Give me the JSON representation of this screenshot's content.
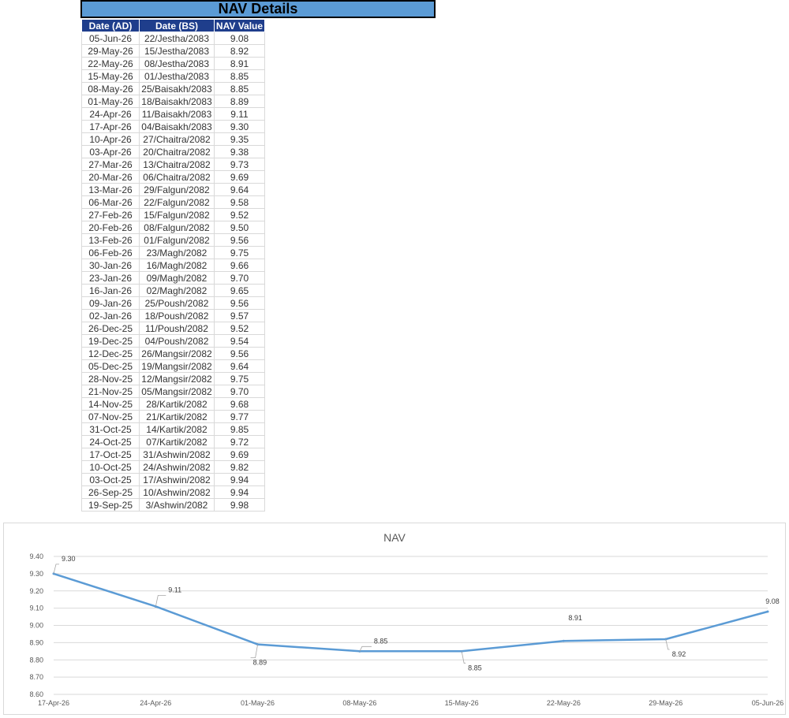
{
  "header": {
    "title": "NAV Details"
  },
  "table": {
    "columns": [
      "Date (AD)",
      "Date (BS)",
      "NAV Value"
    ],
    "rows": [
      [
        "05-Jun-26",
        "22/Jestha/2083",
        "9.08"
      ],
      [
        "29-May-26",
        "15/Jestha/2083",
        "8.92"
      ],
      [
        "22-May-26",
        "08/Jestha/2083",
        "8.91"
      ],
      [
        "15-May-26",
        "01/Jestha/2083",
        "8.85"
      ],
      [
        "08-May-26",
        "25/Baisakh/2083",
        "8.85"
      ],
      [
        "01-May-26",
        "18/Baisakh/2083",
        "8.89"
      ],
      [
        "24-Apr-26",
        "11/Baisakh/2083",
        "9.11"
      ],
      [
        "17-Apr-26",
        "04/Baisakh/2083",
        "9.30"
      ],
      [
        "10-Apr-26",
        "27/Chaitra/2082",
        "9.35"
      ],
      [
        "03-Apr-26",
        "20/Chaitra/2082",
        "9.38"
      ],
      [
        "27-Mar-26",
        "13/Chaitra/2082",
        "9.73"
      ],
      [
        "20-Mar-26",
        "06/Chaitra/2082",
        "9.69"
      ],
      [
        "13-Mar-26",
        "29/Falgun/2082",
        "9.64"
      ],
      [
        "06-Mar-26",
        "22/Falgun/2082",
        "9.58"
      ],
      [
        "27-Feb-26",
        "15/Falgun/2082",
        "9.52"
      ],
      [
        "20-Feb-26",
        "08/Falgun/2082",
        "9.50"
      ],
      [
        "13-Feb-26",
        "01/Falgun/2082",
        "9.56"
      ],
      [
        "06-Feb-26",
        "23/Magh/2082",
        "9.75"
      ],
      [
        "30-Jan-26",
        "16/Magh/2082",
        "9.66"
      ],
      [
        "23-Jan-26",
        "09/Magh/2082",
        "9.70"
      ],
      [
        "16-Jan-26",
        "02/Magh/2082",
        "9.65"
      ],
      [
        "09-Jan-26",
        "25/Poush/2082",
        "9.56"
      ],
      [
        "02-Jan-26",
        "18/Poush/2082",
        "9.57"
      ],
      [
        "26-Dec-25",
        "11/Poush/2082",
        "9.52"
      ],
      [
        "19-Dec-25",
        "04/Poush/2082",
        "9.54"
      ],
      [
        "12-Dec-25",
        "26/Mangsir/2082",
        "9.56"
      ],
      [
        "05-Dec-25",
        "19/Mangsir/2082",
        "9.64"
      ],
      [
        "28-Nov-25",
        "12/Mangsir/2082",
        "9.75"
      ],
      [
        "21-Nov-25",
        "05/Mangsir/2082",
        "9.70"
      ],
      [
        "14-Nov-25",
        "28/Kartik/2082",
        "9.68"
      ],
      [
        "07-Nov-25",
        "21/Kartik/2082",
        "9.77"
      ],
      [
        "31-Oct-25",
        "14/Kartik/2082",
        "9.85"
      ],
      [
        "24-Oct-25",
        "07/Kartik/2082",
        "9.72"
      ],
      [
        "17-Oct-25",
        "31/Ashwin/2082",
        "9.69"
      ],
      [
        "10-Oct-25",
        "24/Ashwin/2082",
        "9.82"
      ],
      [
        "03-Oct-25",
        "17/Ashwin/2082",
        "9.94"
      ],
      [
        "26-Sep-25",
        "10/Ashwin/2082",
        "9.94"
      ],
      [
        "19-Sep-25",
        "3/Ashwin/2082",
        "9.98"
      ]
    ]
  },
  "chart_data": {
    "type": "line",
    "title": "NAV",
    "xlabel": "",
    "ylabel": "",
    "categories": [
      "17-Apr-26",
      "24-Apr-26",
      "01-May-26",
      "08-May-26",
      "15-May-26",
      "22-May-26",
      "29-May-26",
      "05-Jun-26"
    ],
    "series": [
      {
        "values": [
          9.3,
          9.11,
          8.89,
          8.85,
          8.85,
          8.91,
          8.92,
          9.08
        ]
      }
    ],
    "data_labels": [
      "9.30",
      "9.11",
      "8.89",
      "8.85",
      "8.85",
      "8.91",
      "8.92",
      "9.08"
    ],
    "yticks": [
      "8.60",
      "8.70",
      "8.80",
      "8.90",
      "9.00",
      "9.10",
      "9.20",
      "9.30",
      "9.40"
    ],
    "ylim": [
      8.6,
      9.4
    ],
    "grid": true,
    "color": "#5b9bd5"
  }
}
